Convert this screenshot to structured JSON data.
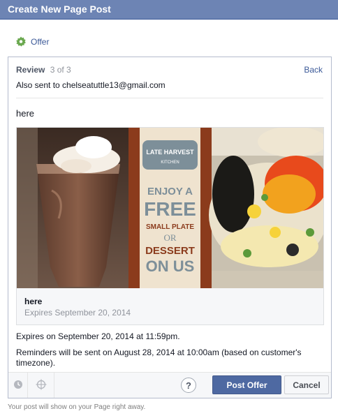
{
  "dialog": {
    "title": "Create New Page Post"
  },
  "offer": {
    "label": "Offer",
    "icon": "offer-tag-icon",
    "accent": "#6aa84f"
  },
  "review": {
    "title": "Review",
    "step": "3 of 3",
    "back_label": "Back",
    "also_sent": "Also sent to chelseatuttle13@gmail.com"
  },
  "post": {
    "message": "here",
    "attachment": {
      "image_text": {
        "brand_line1": "LATE HARVEST",
        "brand_line2": "KITCHEN",
        "line1": "ENJOY A",
        "line2": "FREE",
        "line3": "SMALL PLATE",
        "line4": "OR",
        "line5": "DESSERT",
        "line6": "ON US"
      },
      "title": "here",
      "subtitle": "Expires September 20, 2014"
    },
    "expires_line": "Expires on September 20, 2014 at 11:59pm.",
    "reminder_line": "Reminders will be sent on August 28, 2014 at 10:00am (based on customer's timezone)."
  },
  "footer": {
    "icons": [
      "clock-icon",
      "location-target-icon"
    ],
    "help_label": "?",
    "post_label": "Post Offer",
    "cancel_label": "Cancel"
  },
  "note": "Your post will show on your Page right away.",
  "colors": {
    "header": "#6d84b4",
    "link": "#3b5998",
    "primary_button": "#4e69a2"
  }
}
